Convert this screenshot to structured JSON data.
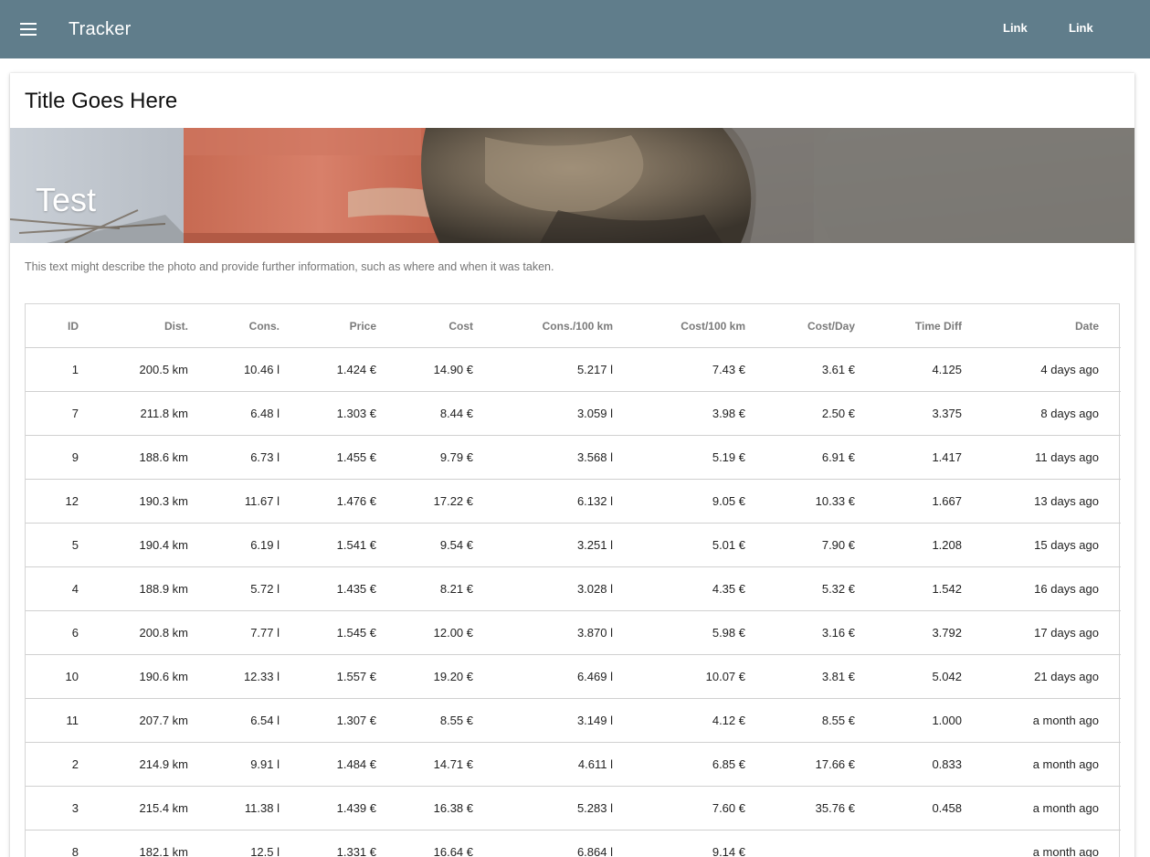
{
  "appbar": {
    "title": "Tracker",
    "menu_icon": "hamburger-menu-icon",
    "links": [
      "Link",
      "Link"
    ],
    "color": "#607d8b"
  },
  "card": {
    "title": "Title Goes Here",
    "media_caption": "Test",
    "supporting_text": "This text might describe the photo and provide further information, such as where and when it was taken."
  },
  "table": {
    "columns": [
      "ID",
      "Dist.",
      "Cons.",
      "Price",
      "Cost",
      "Cons./100 km",
      "Cost/100 km",
      "Cost/Day",
      "Time Diff",
      "Date"
    ],
    "rows": [
      [
        "1",
        "200.5 km",
        "10.46 l",
        "1.424 €",
        "14.90 €",
        "5.217 l",
        "7.43 €",
        "3.61 €",
        "4.125",
        "4 days ago"
      ],
      [
        "7",
        "211.8 km",
        "6.48 l",
        "1.303 €",
        "8.44 €",
        "3.059 l",
        "3.98 €",
        "2.50 €",
        "3.375",
        "8 days ago"
      ],
      [
        "9",
        "188.6 km",
        "6.73 l",
        "1.455 €",
        "9.79 €",
        "3.568 l",
        "5.19 €",
        "6.91 €",
        "1.417",
        "11 days ago"
      ],
      [
        "12",
        "190.3 km",
        "11.67 l",
        "1.476 €",
        "17.22 €",
        "6.132 l",
        "9.05 €",
        "10.33 €",
        "1.667",
        "13 days ago"
      ],
      [
        "5",
        "190.4 km",
        "6.19 l",
        "1.541 €",
        "9.54 €",
        "3.251 l",
        "5.01 €",
        "7.90 €",
        "1.208",
        "15 days ago"
      ],
      [
        "4",
        "188.9 km",
        "5.72 l",
        "1.435 €",
        "8.21 €",
        "3.028 l",
        "4.35 €",
        "5.32 €",
        "1.542",
        "16 days ago"
      ],
      [
        "6",
        "200.8 km",
        "7.77 l",
        "1.545 €",
        "12.00 €",
        "3.870 l",
        "5.98 €",
        "3.16 €",
        "3.792",
        "17 days ago"
      ],
      [
        "10",
        "190.6 km",
        "12.33 l",
        "1.557 €",
        "19.20 €",
        "6.469 l",
        "10.07 €",
        "3.81 €",
        "5.042",
        "21 days ago"
      ],
      [
        "11",
        "207.7 km",
        "6.54 l",
        "1.307 €",
        "8.55 €",
        "3.149 l",
        "4.12 €",
        "8.55 €",
        "1.000",
        "a month ago"
      ],
      [
        "2",
        "214.9 km",
        "9.91 l",
        "1.484 €",
        "14.71 €",
        "4.611 l",
        "6.85 €",
        "17.66 €",
        "0.833",
        "a month ago"
      ],
      [
        "3",
        "215.4 km",
        "11.38 l",
        "1.439 €",
        "16.38 €",
        "5.283 l",
        "7.60 €",
        "35.76 €",
        "0.458",
        "a month ago"
      ],
      [
        "8",
        "182.1 km",
        "12.5 l",
        "1.331 €",
        "16.64 €",
        "6.864 l",
        "9.14 €",
        "",
        "",
        "a month ago"
      ]
    ]
  }
}
